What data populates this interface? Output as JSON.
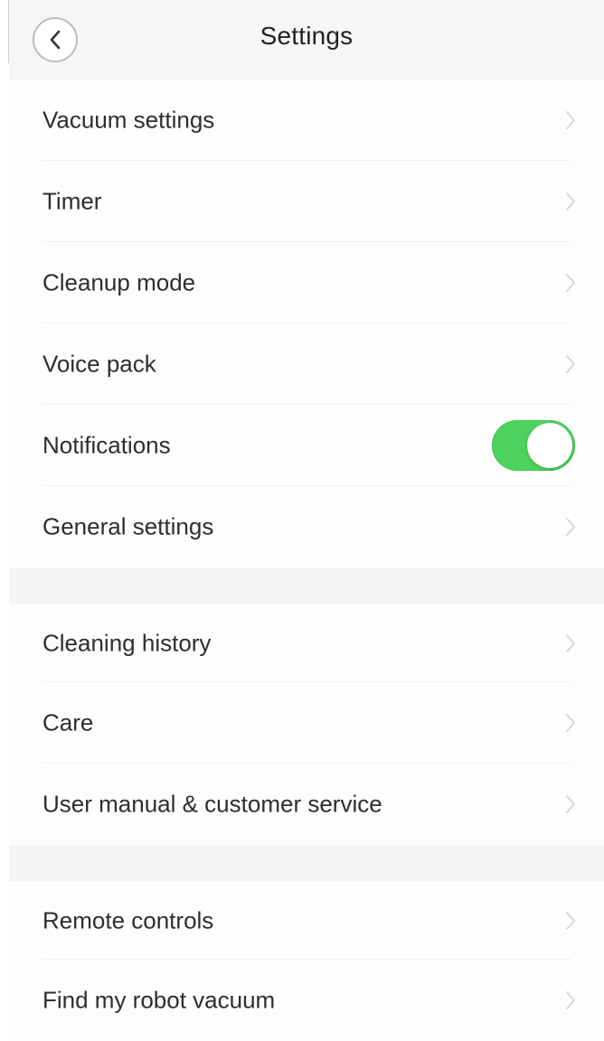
{
  "header": {
    "title": "Settings",
    "back_icon": "chevron-left-icon"
  },
  "sections": [
    {
      "items": [
        {
          "label": "Vacuum settings",
          "control": "chevron"
        },
        {
          "label": "Timer",
          "control": "chevron"
        },
        {
          "label": "Cleanup mode",
          "control": "chevron"
        },
        {
          "label": "Voice pack",
          "control": "chevron"
        },
        {
          "label": "Notifications",
          "control": "toggle",
          "toggle_on": true
        },
        {
          "label": "General settings",
          "control": "chevron"
        }
      ]
    },
    {
      "items": [
        {
          "label": "Cleaning history",
          "control": "chevron"
        },
        {
          "label": "Care",
          "control": "chevron"
        },
        {
          "label": "User manual & customer service",
          "control": "chevron"
        }
      ]
    },
    {
      "items": [
        {
          "label": "Remote controls",
          "control": "chevron"
        },
        {
          "label": "Find my robot vacuum",
          "control": "chevron"
        }
      ]
    }
  ],
  "colors": {
    "toggle_on": "#4cd35e",
    "chevron": "#d8d8d8",
    "section_gap": "#f5f5f5",
    "header_bg": "#f6f6f6"
  }
}
